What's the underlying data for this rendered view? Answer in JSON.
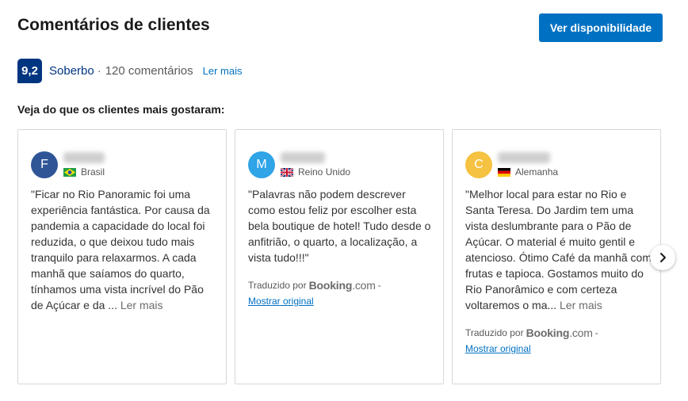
{
  "header": {
    "title": "Comentários de clientes",
    "cta_label": "Ver disponibilidade"
  },
  "score": {
    "value": "9,2",
    "word": "Soberbo",
    "separator": "·",
    "count": "120 comentários",
    "read_more": "Ler mais"
  },
  "subheading": "Veja do que os clientes mais gostaram:",
  "reviews": [
    {
      "initial": "F",
      "avatar_color": "#2f5597",
      "country": "Brasil",
      "flag": "brazil-flag",
      "text": "\"Ficar no Rio Panoramic foi uma experiência fantástica. Por causa da pandemia a capacidade do local foi reduzida, o que deixou tudo mais tranquilo para relaxarmos. A cada manhã que saíamos do quarto, tínhamos uma vista incrível do Pão de Açúcar e da ...",
      "read_more": "Ler mais"
    },
    {
      "initial": "M",
      "avatar_color": "#2fa4e7",
      "country": "Reino Unido",
      "flag": "uk-flag",
      "text": "\"Palavras não podem descrever como estou feliz por escolher esta bela boutique de hotel! Tudo desde o anfitrião, o quarto, a localização, a vista tudo!!!\"",
      "translated_prefix": "Traduzido por",
      "brand": "Booking",
      "brand_suffix": ".com",
      "dash": "-",
      "show_original": "Mostrar original"
    },
    {
      "initial": "C",
      "avatar_color": "#f5c242",
      "country": "Alemanha",
      "flag": "germany-flag",
      "text": "\"Melhor local para estar no Rio e Santa Teresa. Do Jardim tem uma vista deslumbrante para o Pão de Açúcar. O material é muito gentil e atencioso. Ótimo Café da manhã com frutas e tapioca. Gostamos muito do Rio Panorâmico e com certeza voltaremos o ma...",
      "read_more": "Ler mais",
      "translated_prefix": "Traduzido por",
      "brand": "Booking",
      "brand_suffix": ".com",
      "dash": "-",
      "show_original": "Mostrar original"
    }
  ],
  "carousel": {
    "next_icon": "chevron-right-icon"
  }
}
